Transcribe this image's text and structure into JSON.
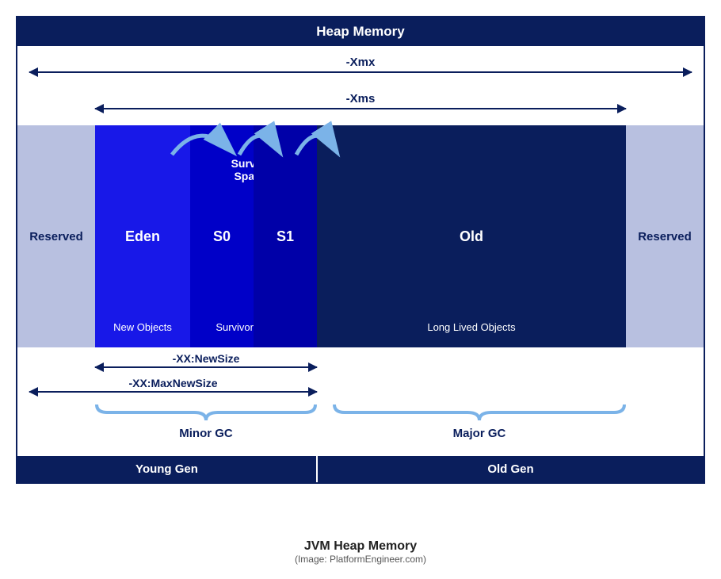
{
  "header": {
    "title": "Heap Memory"
  },
  "sizing": {
    "xmx": "-Xmx",
    "xms": "-Xms",
    "newsize": "-XX:NewSize",
    "maxnewsize": "-XX:MaxNewSize"
  },
  "segments": {
    "reserved": "Reserved",
    "eden": {
      "title": "Eden",
      "sub": "New Objects"
    },
    "survivor_label": "Survivor\nSpaces",
    "s0": "S0",
    "s1": "S1",
    "survivor_sub": "Survivor Objects",
    "old": {
      "title": "Old",
      "sub": "Long Lived Objects"
    }
  },
  "gc": {
    "minor": "Minor GC",
    "major": "Major GC"
  },
  "footer": {
    "young": "Young Gen",
    "old": "Old Gen"
  },
  "caption": {
    "title": "JVM Heap Memory",
    "sub": "(Image: PlatformEngineer.com)"
  }
}
